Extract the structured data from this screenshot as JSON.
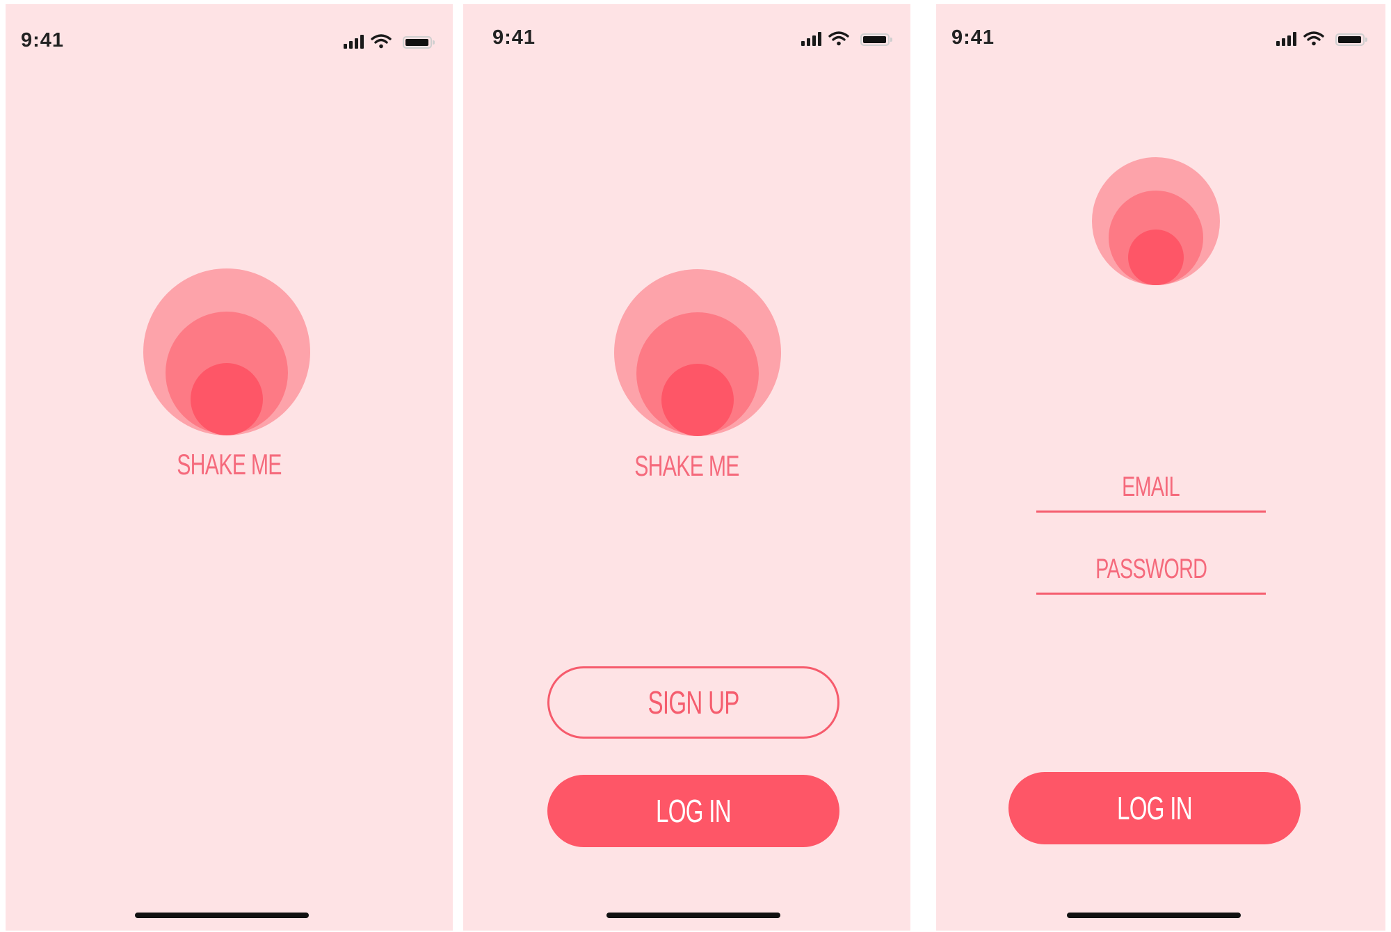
{
  "status_bar": {
    "time": "9:41"
  },
  "colors": {
    "background": "#fee3e5",
    "accent": "#fe5667",
    "logo_outer": "#fda3aa",
    "logo_middle": "#fd7a85",
    "logo_inner": "#fe5667"
  },
  "screens": [
    {
      "logo_text": "SHAKE ME"
    },
    {
      "logo_text": "SHAKE ME",
      "signup_label": "SIGN UP",
      "login_label": "LOG IN"
    },
    {
      "email_placeholder": "EMAIL",
      "password_placeholder": "PASSWORD",
      "login_label": "LOG IN"
    }
  ]
}
